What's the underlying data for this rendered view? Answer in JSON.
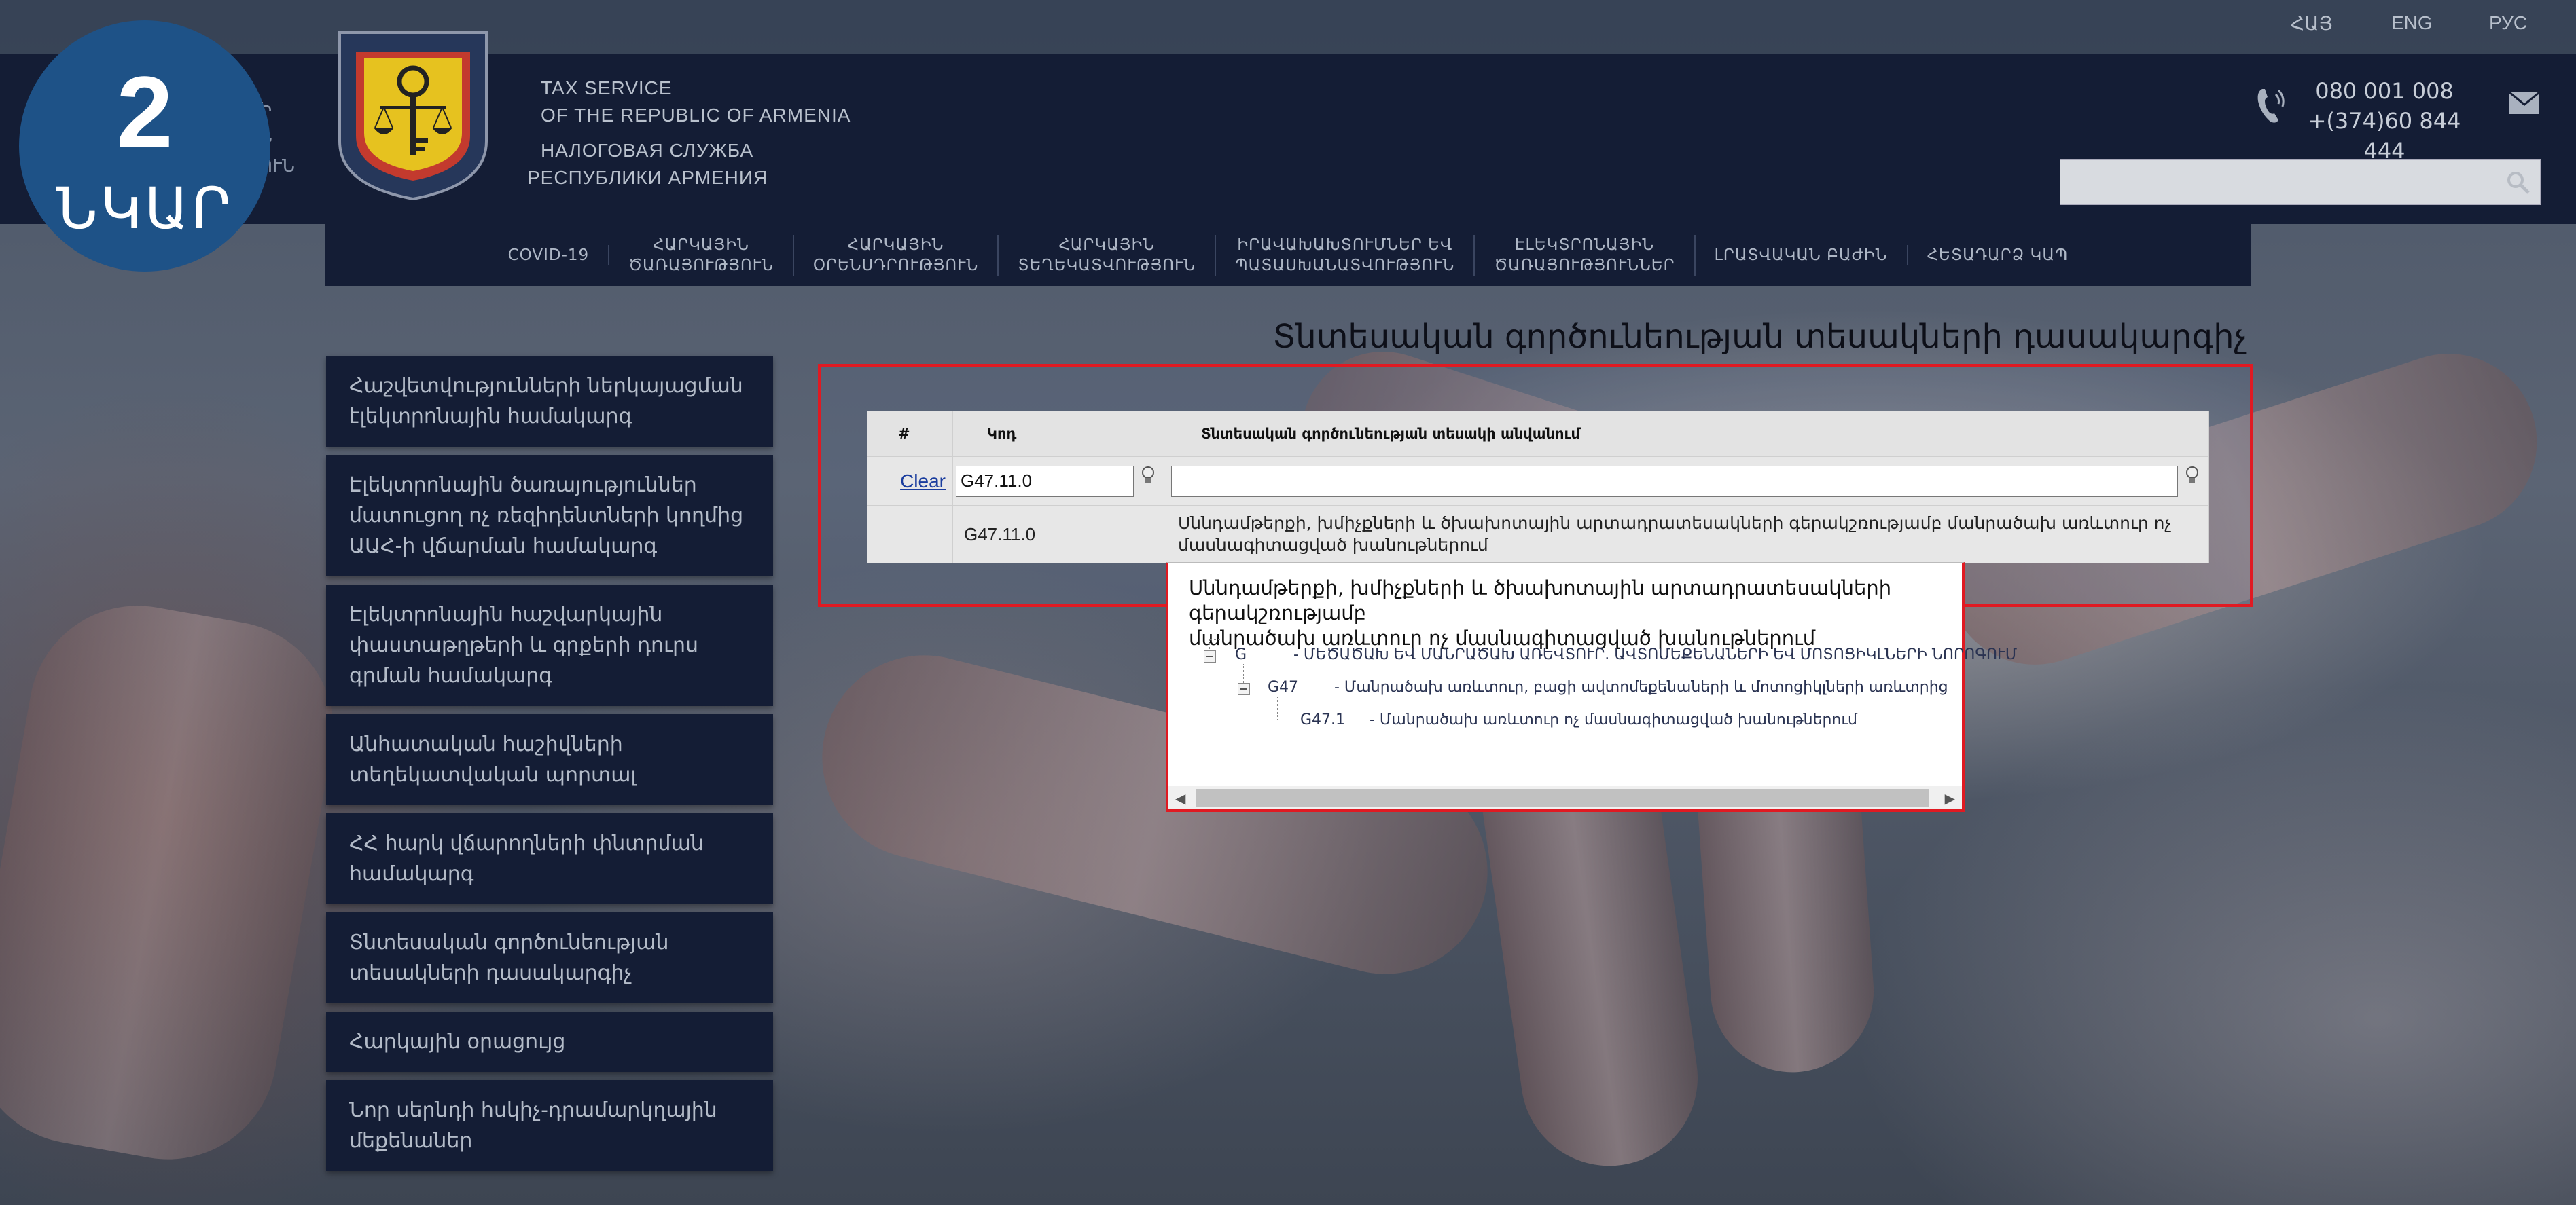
{
  "badge": {
    "number": "2",
    "word": "ՆԿԱՐ"
  },
  "languages": [
    "ՀԱՅ",
    "ENG",
    "РУС"
  ],
  "header_left_hidden": [
    "Ի",
    "Ն",
    "ՈՒՆ"
  ],
  "org": {
    "en_line1": "TAX SERVICE",
    "en_line2": "OF THE REPUBLIC OF ARMENIA",
    "ru_line1": "НАЛОГОВАЯ СЛУЖБА",
    "ru_line2": "РЕСПУБЛИКИ АРМЕНИЯ"
  },
  "contacts": {
    "phone1": "080 001 008",
    "phone2": "+(374)60 844 444"
  },
  "search": {
    "placeholder": ""
  },
  "nav": [
    {
      "line1": "COVID-19",
      "line2": ""
    },
    {
      "line1": "ՀԱՐԿԱՅԻՆ",
      "line2": "ԾԱՌԱՅՈՒԹՅՈՒՆ"
    },
    {
      "line1": "ՀԱՐԿԱՅԻՆ",
      "line2": "ՕՐԵՆՍԴՐՈՒԹՅՈՒՆ"
    },
    {
      "line1": "ՀԱՐԿԱՅԻՆ",
      "line2": "ՏԵՂԵԿԱՏՎՈՒԹՅՈՒՆ"
    },
    {
      "line1": "ԻՐԱՎԱԽԱԽՏՈՒՄՆԵՐ ԵՎ",
      "line2": "ՊԱՏԱՍԽԱՆԱՏՎՈՒԹՅՈՒՆ"
    },
    {
      "line1": "ԷԼԵԿՏՐՈՆԱՅԻՆ",
      "line2": "ԾԱՌԱՅՈՒԹՅՈՒՆՆԵՐ"
    },
    {
      "line1": "ԼՐԱՏՎԱԿԱՆ ԲԱԺԻՆ",
      "line2": ""
    },
    {
      "line1": "ՀԵՏԱԴԱՐՁ ԿԱՊ",
      "line2": ""
    }
  ],
  "page_title": "Տնտեսական գործունեության տեսակների դասակարգիչ",
  "sidebar": [
    {
      "line1": "Հաշվետվությունների ներկայացման",
      "line2": "էլեկտրոնային համակարգ",
      "line3": ""
    },
    {
      "line1": "Էլեկտրոնային ծառայություններ",
      "line2": "մատուցող ոչ ռեզիդենտների կողմից",
      "line3": "ԱԱՀ-ի վճարման համակարգ"
    },
    {
      "line1": "Էլեկտրոնային հաշվարկային",
      "line2": "փաստաթղթերի և գրքերի դուրս",
      "line3": "գրման համակարգ"
    },
    {
      "line1": "Անհատական հաշիվների",
      "line2": "տեղեկատվական պորտալ",
      "line3": ""
    },
    {
      "line1": "ՀՀ հարկ վճարողների փնտրման",
      "line2": "համակարգ",
      "line3": ""
    },
    {
      "line1": "Տնտեսական գործունեության",
      "line2": "տեսակների դասակարգիչ",
      "line3": ""
    },
    {
      "line1": "Հարկային օրացույց",
      "line2": "",
      "line3": ""
    },
    {
      "line1": "Նոր սերնդի հսկիչ-դրամարկղային",
      "line2": "մեքենաներ",
      "line3": ""
    }
  ],
  "grid": {
    "headers": {
      "num": "#",
      "code": "Կոդ",
      "name": "Տնտեսական գործունեության տեսակի անվանում"
    },
    "filter": {
      "clear_label": "Clear",
      "code_value": "G47.11.0",
      "name_value": ""
    },
    "row": {
      "code": "G47.11.0",
      "desc_line1": "Սննդամթերքի, խմիչքների և ծխախոտային արտադրատեսակների գերակշռությամբ մանրածախ առևտուր ոչ",
      "desc_line2": "մասնագիտացված խանութներում"
    }
  },
  "popup": {
    "title_line1": "Սննդամթերքի, խմիչքների և ծխախոտային արտադրատեսակների գերակշռությամբ",
    "title_line2": "մանրածախ առևտուր ոչ մասնագիտացված խանութներում",
    "tree": [
      {
        "code": "G",
        "label": "- ՄԵԾԱԾԱԽ ԵՎ ՄԱՆՐԱԾԱԽ ԱՌԵՎՏՈՒՐ. ԱՎՏՈՄԵՔԵՆԱՆԵՐԻ ԵՎ ՄՈՏՈՑԻԿԼՆԵՐԻ ՆՈՐՈԳՈՒՄ"
      },
      {
        "code": "G47",
        "label": "- Մանրածախ առևտուր, բացի ավտոմեքենաների և մոտոցիկլների առևտրից"
      },
      {
        "code": "G47.1",
        "label": "- Մանրածախ առևտուր ոչ մասնագիտացված խանութներում"
      }
    ]
  },
  "colors": {
    "header": "#141d35",
    "badge": "#1e5287",
    "highlight_border": "#e01a22",
    "link": "#1a3d9e"
  }
}
